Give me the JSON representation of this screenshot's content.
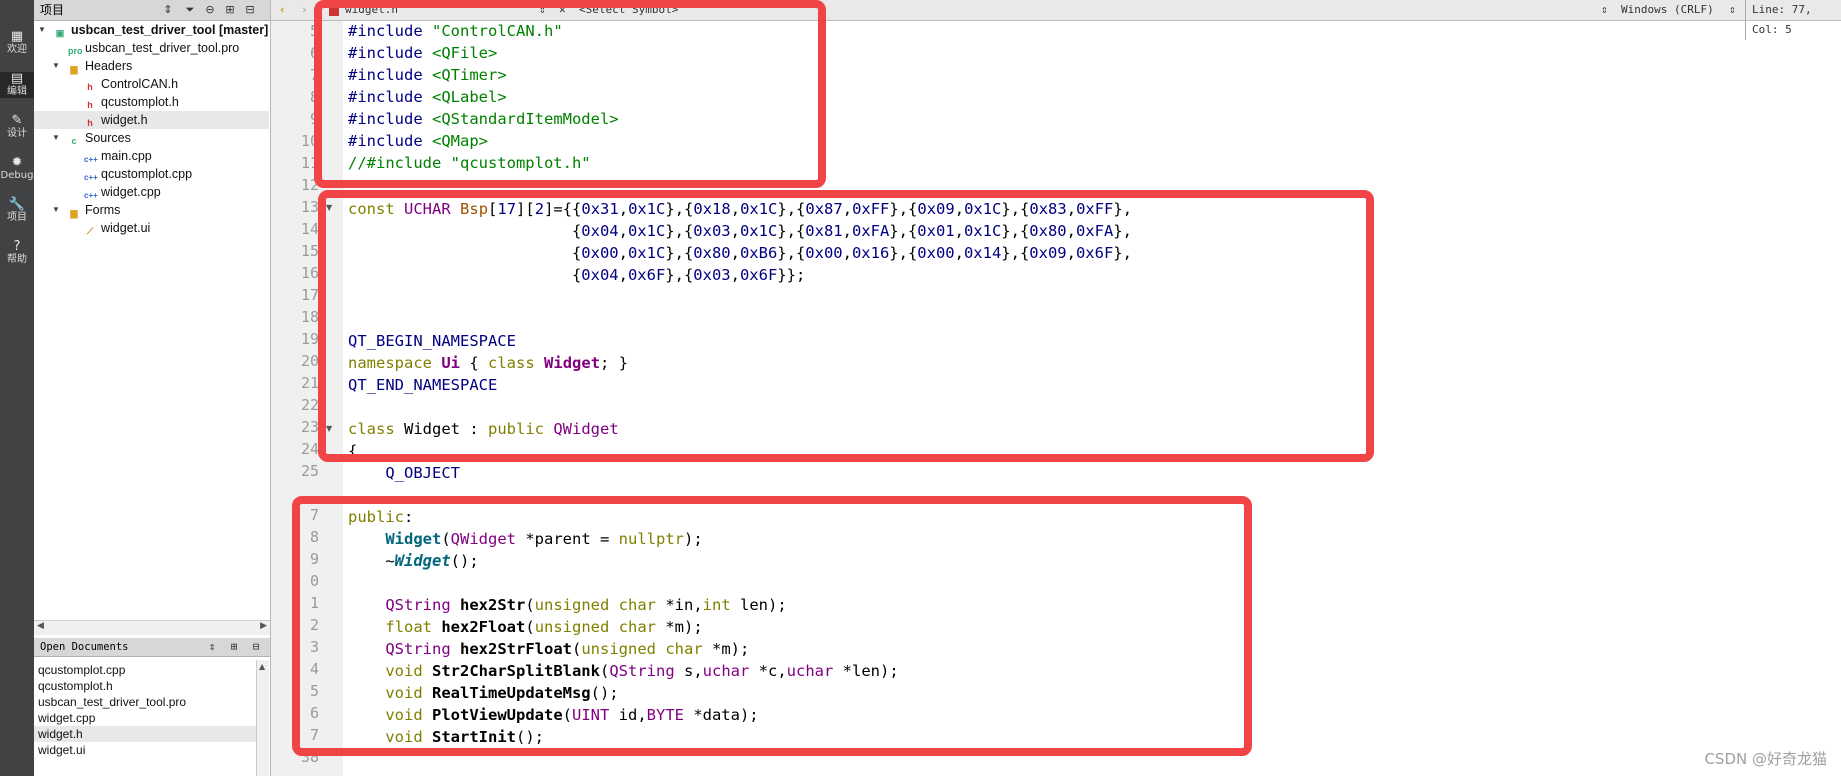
{
  "mode_bar": [
    {
      "icon": "welcome-icon",
      "label": "欢迎"
    },
    {
      "icon": "edit-icon",
      "label": "编辑"
    },
    {
      "icon": "design-icon",
      "label": "设计"
    },
    {
      "icon": "debug-icon",
      "label": "Debug"
    },
    {
      "icon": "projects-icon",
      "label": "项目"
    },
    {
      "icon": "help-icon",
      "label": "帮助"
    }
  ],
  "project_pane": {
    "title": "项目",
    "tree": [
      {
        "label": "usbcan_test_driver_tool [master]",
        "type": "project",
        "bold": true
      },
      {
        "label": "usbcan_test_driver_tool.pro",
        "type": "pro"
      },
      {
        "label": "Headers",
        "type": "folder"
      },
      {
        "label": "ControlCAN.h",
        "type": "header"
      },
      {
        "label": "qcustomplot.h",
        "type": "header"
      },
      {
        "label": "widget.h",
        "type": "header",
        "selected": true
      },
      {
        "label": "Sources",
        "type": "folder"
      },
      {
        "label": "main.cpp",
        "type": "cpp"
      },
      {
        "label": "qcustomplot.cpp",
        "type": "cpp"
      },
      {
        "label": "widget.cpp",
        "type": "cpp"
      },
      {
        "label": "Forms",
        "type": "folder"
      },
      {
        "label": "widget.ui",
        "type": "ui"
      }
    ]
  },
  "open_documents": {
    "title": "Open Documents",
    "items": [
      "qcustomplot.cpp",
      "qcustomplot.h",
      "usbcan_test_driver_tool.pro",
      "widget.cpp",
      "widget.h",
      "widget.ui"
    ],
    "selected": "widget.h"
  },
  "editor_toolbar": {
    "file": "widget.h",
    "symbol": "<Select Symbol>",
    "line_ending": "Windows (CRLF)",
    "position": "Line: 77, Col: 5"
  },
  "line_numbers": [
    "5",
    "6",
    "7",
    "8",
    "9",
    "10",
    "11",
    "12",
    "13",
    "14",
    "15",
    "16",
    "17",
    "18",
    "19",
    "20",
    "21",
    "22",
    "23",
    "24",
    "25",
    "",
    "7",
    "8",
    "9",
    "0",
    "1",
    "2",
    "3",
    "4",
    "5",
    "6",
    "7",
    "38"
  ],
  "watermark": "CSDN @好奇龙猫",
  "colors": {
    "highlight_box": "#f04446",
    "keyword": "#808000",
    "string": "#008000",
    "number": "#000080",
    "type": "#800080"
  }
}
